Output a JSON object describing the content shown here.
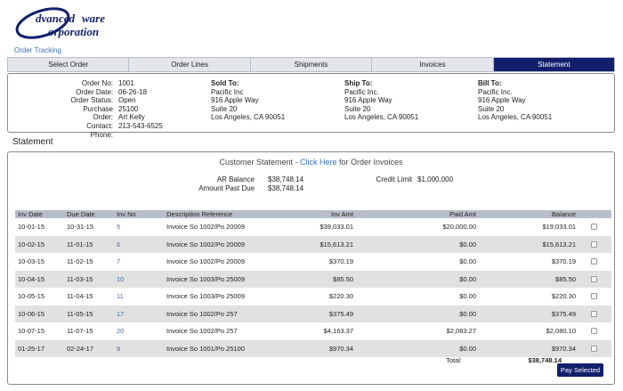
{
  "brand": {
    "logo_alt": "AdvancedWare Corporation"
  },
  "nav": {
    "order_tracking": "Order Tracking"
  },
  "tabs": [
    {
      "label": "Select Order",
      "active": false
    },
    {
      "label": "Order Lines",
      "active": false
    },
    {
      "label": "Shipments",
      "active": false
    },
    {
      "label": "Invoices",
      "active": false
    },
    {
      "label": "Statement",
      "active": true
    }
  ],
  "order": {
    "labels": [
      "Order No:",
      "Order Date:",
      "Order Status:",
      "Purchase Order:",
      "Contact:",
      "Phone:"
    ],
    "values": [
      "1001",
      "06-26-18",
      "Open",
      "25100",
      "Art Kelly",
      "213-543-6525"
    ]
  },
  "sold_to": {
    "heading": "Sold To:",
    "lines": [
      "Pacific Inc",
      "916 Apple Way",
      "Suite 20",
      "Los Angeles, CA 90051"
    ]
  },
  "ship_to": {
    "heading": "Ship To:",
    "lines": [
      "Pacific Inc.",
      "916 Apple Way",
      "Suite 20",
      "Los Angeles, CA 90051"
    ]
  },
  "bill_to": {
    "heading": "Bill To:",
    "lines": [
      "Pacific Inc.",
      "916 Apple Way",
      "Suite 20",
      "Los Angeles, CA 90051"
    ]
  },
  "statement": {
    "heading": "Statement",
    "title_prefix": "Customer Statement - ",
    "title_link": "Click Here",
    "title_suffix": " for Order Invoices",
    "ar_balance_label": "AR Balance",
    "ar_balance_value": "$38,748.14",
    "past_due_label": "Amount Past Due",
    "past_due_value": "$38,748.14",
    "credit_limit_label": "Credit Limit",
    "credit_limit_value": "$1,000,000"
  },
  "table": {
    "headers": [
      "Inv Date",
      "Due Date",
      "Inv No",
      "Description Reference",
      "Inv Amt",
      "Paid Amt",
      "Balance"
    ],
    "rows": [
      [
        "10-01-15",
        "10-31-15",
        "5",
        "Invoice So 1002/Po 20009",
        "$39,033.01",
        "$20,000.00",
        "$19,033.01"
      ],
      [
        "10-02-15",
        "11-01-15",
        "6",
        "Invoice So 1002/Po 20009",
        "$15,613.21",
        "$0.00",
        "$15,613.21"
      ],
      [
        "10-03-15",
        "11-02-15",
        "7",
        "Invoice So 1002/Po 20009",
        "$370.19",
        "$0.00",
        "$370.19"
      ],
      [
        "10-04-15",
        "11-03-15",
        "10",
        "Invoice So 1003/Po 25009",
        "$85.50",
        "$0.00",
        "$85.50"
      ],
      [
        "10-05-15",
        "11-04-15",
        "11",
        "Invoice So 1003/Po 25009",
        "$220.30",
        "$0.00",
        "$220.30"
      ],
      [
        "10-06-15",
        "11-05-15",
        "17",
        "Invoice So 1002/Po 257",
        "$375.49",
        "$0.00",
        "$375.49"
      ],
      [
        "10-07-15",
        "11-07-15",
        "20",
        "Invoice So 1002/Po 257",
        "$4,163.37",
        "$2,083.27",
        "$2,080.10"
      ],
      [
        "01-25-17",
        "02-24-17",
        "9",
        "Invoice So 1001/Po 25100",
        "$970.34",
        "$0.00",
        "$970.34"
      ]
    ],
    "total_label": "Total:",
    "total_value": "$38,748.14"
  },
  "actions": {
    "pay_selected": "Pay Selected"
  },
  "colors": {
    "accent": "#131f6b",
    "link": "#3a6fb5",
    "header_row": "#b9bfca"
  }
}
